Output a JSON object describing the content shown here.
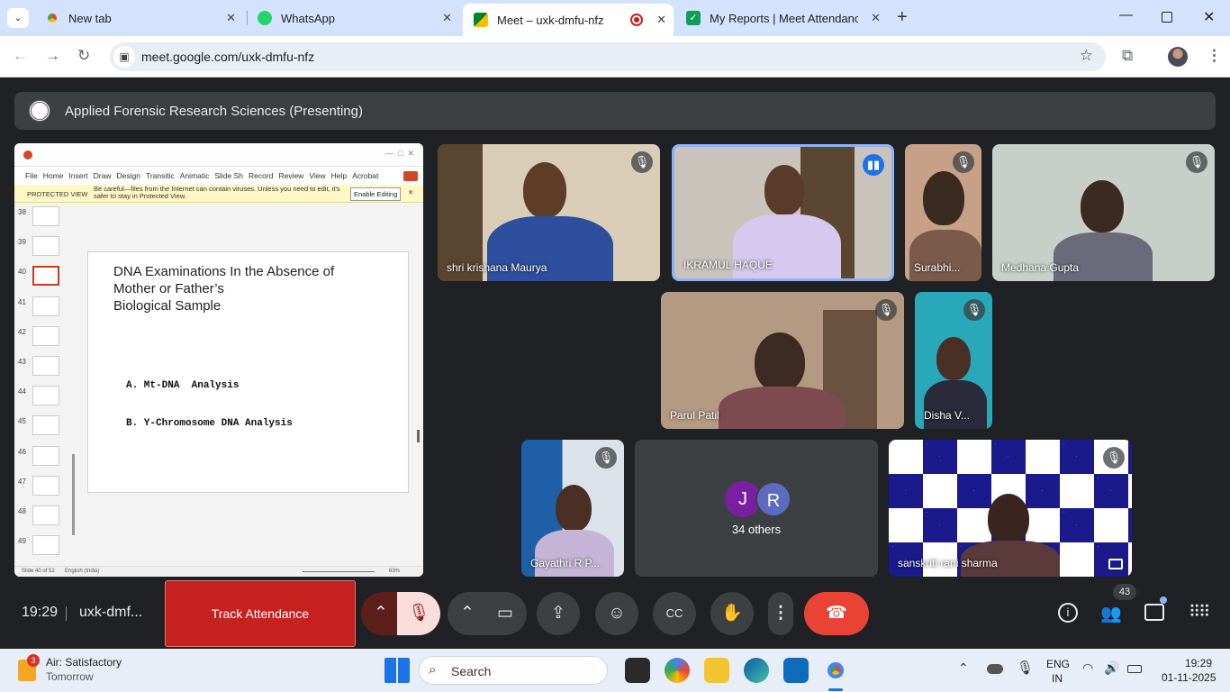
{
  "browser": {
    "tabs": [
      {
        "label": "New tab"
      },
      {
        "label": "WhatsApp"
      },
      {
        "label": "Meet – uxk-dmfu-nfz"
      },
      {
        "label": "My Reports | Meet Attendance"
      }
    ],
    "url": "meet.google.com/uxk-dmfu-nfz"
  },
  "meet": {
    "presenting_title": "Applied Forensic Research Sciences (Presenting)",
    "slide_app": {
      "ribbon_tabs": [
        "File",
        "Home",
        "Insert",
        "Draw",
        "Design",
        "Transitic",
        "Animatic",
        "Slide Sh",
        "Record",
        "Review",
        "View",
        "Help",
        "Acrobat"
      ],
      "protected_label": "PROTECTED VIEW",
      "protected_msg": "Be careful—files from the Internet can contain viruses. Unless you need to edit, it's safer to stay in Protected View.",
      "enable_editing": "Enable Editing",
      "thumb_numbers": [
        "38",
        "39",
        "40",
        "41",
        "42",
        "43",
        "44",
        "45",
        "46",
        "47",
        "48",
        "49"
      ],
      "slide_title_1": "DNA Examinations In the Absence of",
      "slide_title_2": "Mother or Father’s",
      "slide_title_3": "Biological Sample",
      "bullet_a": "A. Mt-DNA  Analysis",
      "bullet_b": "B. Y-Chromosome DNA Analysis",
      "status_slide": "Slide 40 of 52",
      "status_lang": "English (India)",
      "status_zoom": "63%"
    },
    "participants": [
      {
        "name": "shri krishana Maurya",
        "muted": true
      },
      {
        "name": "IKRAMUL HAQUE",
        "muted": false
      },
      {
        "name": "Surabhi...",
        "muted": true
      },
      {
        "name": "Medhana Gupta",
        "muted": true
      },
      {
        "name": "Parul Patil",
        "muted": true
      },
      {
        "name": "Disha V...",
        "muted": true
      },
      {
        "name": "Gayathri R P...",
        "muted": true
      },
      {
        "name": "sanskriti rani sharma",
        "muted": true
      }
    ],
    "others": {
      "avatars": [
        "J",
        "R"
      ],
      "label": "34 others"
    },
    "bottom": {
      "time": "19:29",
      "code": "uxk-dmf...",
      "track_attendance": "Track Attendance",
      "participant_count": "43"
    }
  },
  "taskbar": {
    "weather_title": "Air: Satisfactory",
    "weather_sub": "Tomorrow",
    "weather_badge": "3",
    "search": "Search",
    "lang_1": "ENG",
    "lang_2": "IN",
    "clock_time": "19:29",
    "clock_date": "01-11-2025"
  },
  "colors": {
    "meet_bg": "#202124",
    "end_call": "#ea4335",
    "track": "#c5221f",
    "afrs_blue": "#1a1a8c"
  }
}
